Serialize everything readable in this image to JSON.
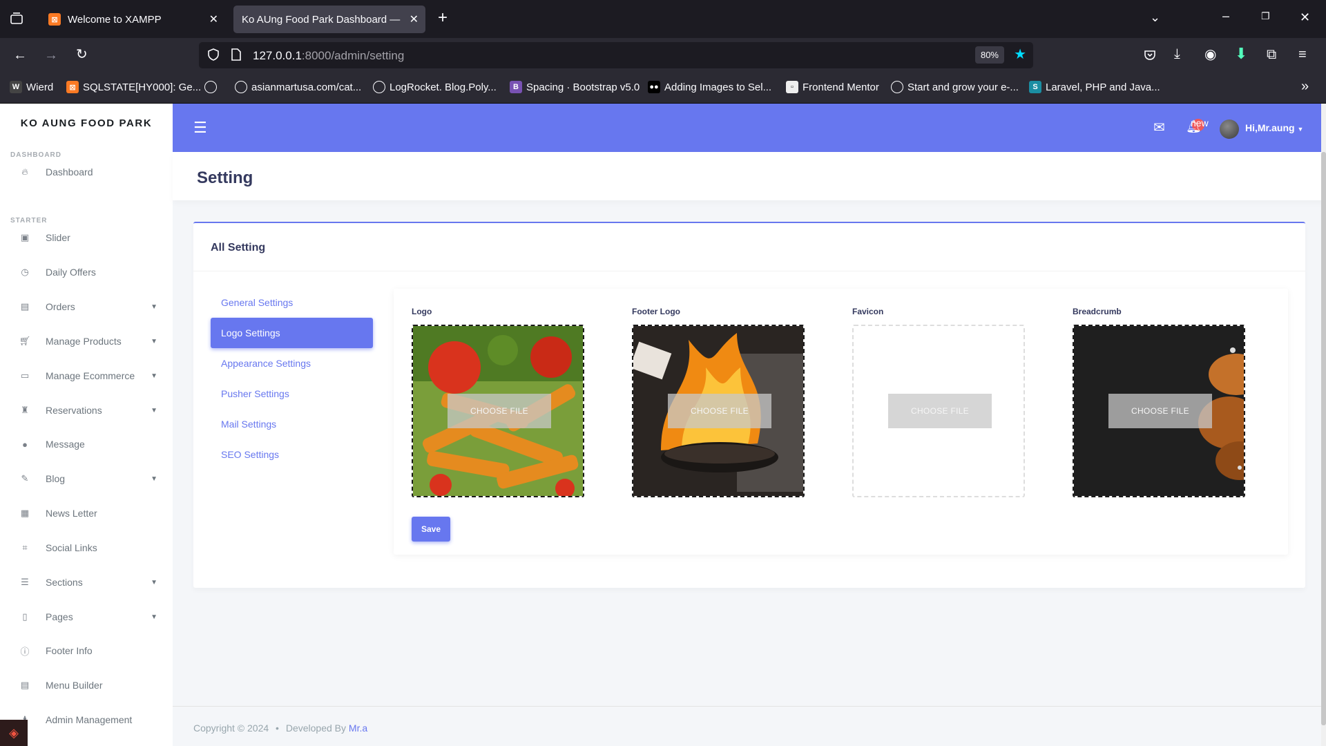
{
  "browser": {
    "tabs": [
      {
        "title": "Welcome to XAMPP",
        "active": false
      },
      {
        "title": "Ko AUng Food Park Dashboard — S",
        "active": true
      }
    ],
    "new_tab": "+",
    "url_host": "127.0.0.1",
    "url_path": ":8000/admin/setting",
    "zoom": "80%",
    "bookmarks": [
      "Wierd",
      "SQLSTATE[HY000]: Ge...",
      "",
      "asianmartusa.com/cat...",
      "LogRocket. Blog.Poly...",
      "Spacing · Bootstrap v5.0",
      "Adding Images to Sel...",
      "Frontend Mentor",
      "Start and grow your e-...",
      "Laravel, PHP and Java..."
    ]
  },
  "sidebar": {
    "brand": "KO AUNG FOOD PARK",
    "headers": [
      "DASHBOARD",
      "STARTER"
    ],
    "items": [
      {
        "label": "Dashboard",
        "icon": "fire-icon",
        "caret": false
      },
      {
        "label": "Slider",
        "icon": "image-icon",
        "caret": false
      },
      {
        "label": "Daily Offers",
        "icon": "clock-icon",
        "caret": false
      },
      {
        "label": "Orders",
        "icon": "box-icon",
        "caret": true
      },
      {
        "label": "Manage Products",
        "icon": "cart-icon",
        "caret": true
      },
      {
        "label": "Manage Ecommerce",
        "icon": "wallet-icon",
        "caret": true
      },
      {
        "label": "Reservations",
        "icon": "chair-icon",
        "caret": true
      },
      {
        "label": "Message",
        "icon": "chat-icon",
        "caret": false
      },
      {
        "label": "Blog",
        "icon": "blog-icon",
        "caret": true
      },
      {
        "label": "News Letter",
        "icon": "newsletter-icon",
        "caret": false
      },
      {
        "label": "Social Links",
        "icon": "link-icon",
        "caret": false
      },
      {
        "label": "Sections",
        "icon": "list-icon",
        "caret": true
      },
      {
        "label": "Pages",
        "icon": "page-icon",
        "caret": true
      },
      {
        "label": "Footer Info",
        "icon": "info-icon",
        "caret": false
      },
      {
        "label": "Menu Builder",
        "icon": "menu-icon",
        "caret": false
      },
      {
        "label": "Admin Management",
        "icon": "user-icon",
        "caret": false
      }
    ]
  },
  "topbar": {
    "badge": "new",
    "user": "Hi,Mr.aung"
  },
  "page": {
    "title": "Setting",
    "card_title": "All Setting",
    "sub_nav": [
      {
        "label": "General Settings",
        "active": false
      },
      {
        "label": "Logo Settings",
        "active": true
      },
      {
        "label": "Appearance Settings",
        "active": false
      },
      {
        "label": "Pusher Settings",
        "active": false
      },
      {
        "label": "Mail Settings",
        "active": false
      },
      {
        "label": "SEO Settings",
        "active": false
      }
    ],
    "uploads": [
      {
        "label": "Logo",
        "button": "CHOOSE FILE",
        "image": "pasta"
      },
      {
        "label": "Footer Logo",
        "button": "CHOOSE FILE",
        "image": "flame-wok"
      },
      {
        "label": "Favicon",
        "button": "CHOOSE FILE",
        "image": "none"
      },
      {
        "label": "Breadcrumb",
        "button": "CHOOSE FILE",
        "image": "chicken"
      }
    ],
    "save": "Save"
  },
  "footer": {
    "copyright": "Copyright © 2024",
    "developed_by": "Developed By",
    "author": "Mr.a"
  },
  "colors": {
    "primary": "#6777ef",
    "browser_dark": "#1c1b22"
  }
}
